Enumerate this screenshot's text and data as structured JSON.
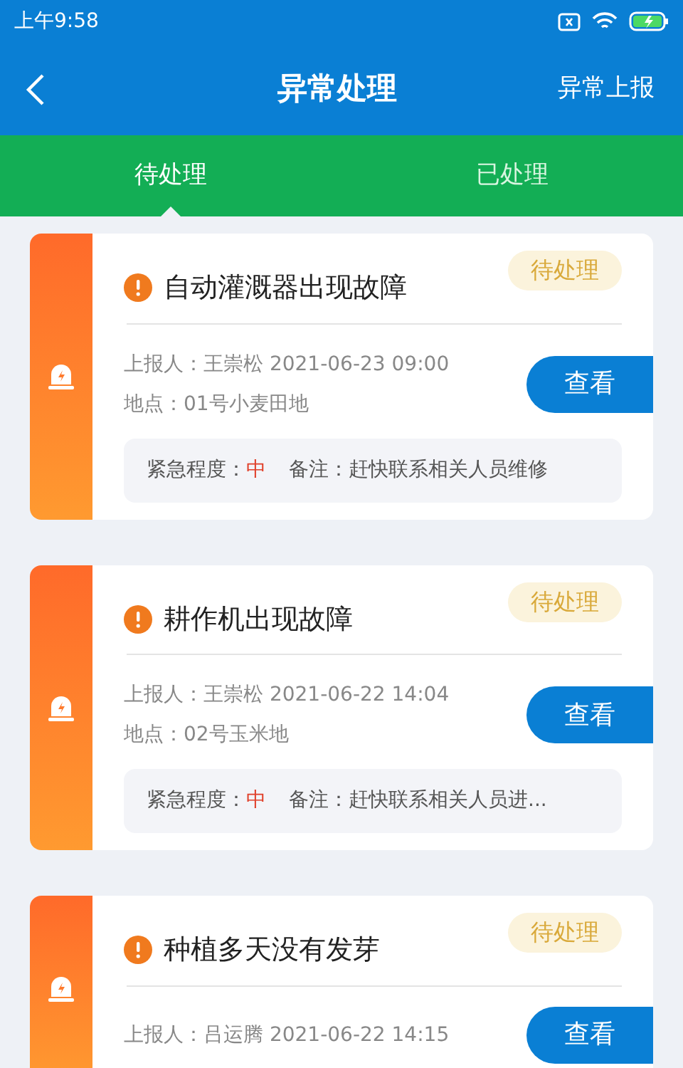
{
  "status_bar": {
    "time": "上午9:58"
  },
  "header": {
    "title": "异常处理",
    "action": "异常上报"
  },
  "tabs": [
    {
      "label": "待处理",
      "selected": true
    },
    {
      "label": "已处理",
      "selected": false
    }
  ],
  "cards": [
    {
      "title": "自动灌溉器出现故障",
      "status": "待处理",
      "reporter": "上报人：王崇松 2021-06-23 09:00",
      "location": "地点：01号小麦田地",
      "urgency_label": "紧急程度：",
      "urgency": "中",
      "note": "备注：赶快联系相关人员维修",
      "button": "查看"
    },
    {
      "title": "耕作机出现故障",
      "status": "待处理",
      "reporter": "上报人：王崇松 2021-06-22 14:04",
      "location": "地点：02号玉米地",
      "urgency_label": "紧急程度：",
      "urgency": "中",
      "note": "备注：赶快联系相关人员进...",
      "button": "查看"
    },
    {
      "title": "种植多天没有发芽",
      "status": "待处理",
      "reporter": "上报人：吕运腾 2021-06-22 14:15",
      "button": "查看"
    }
  ]
}
